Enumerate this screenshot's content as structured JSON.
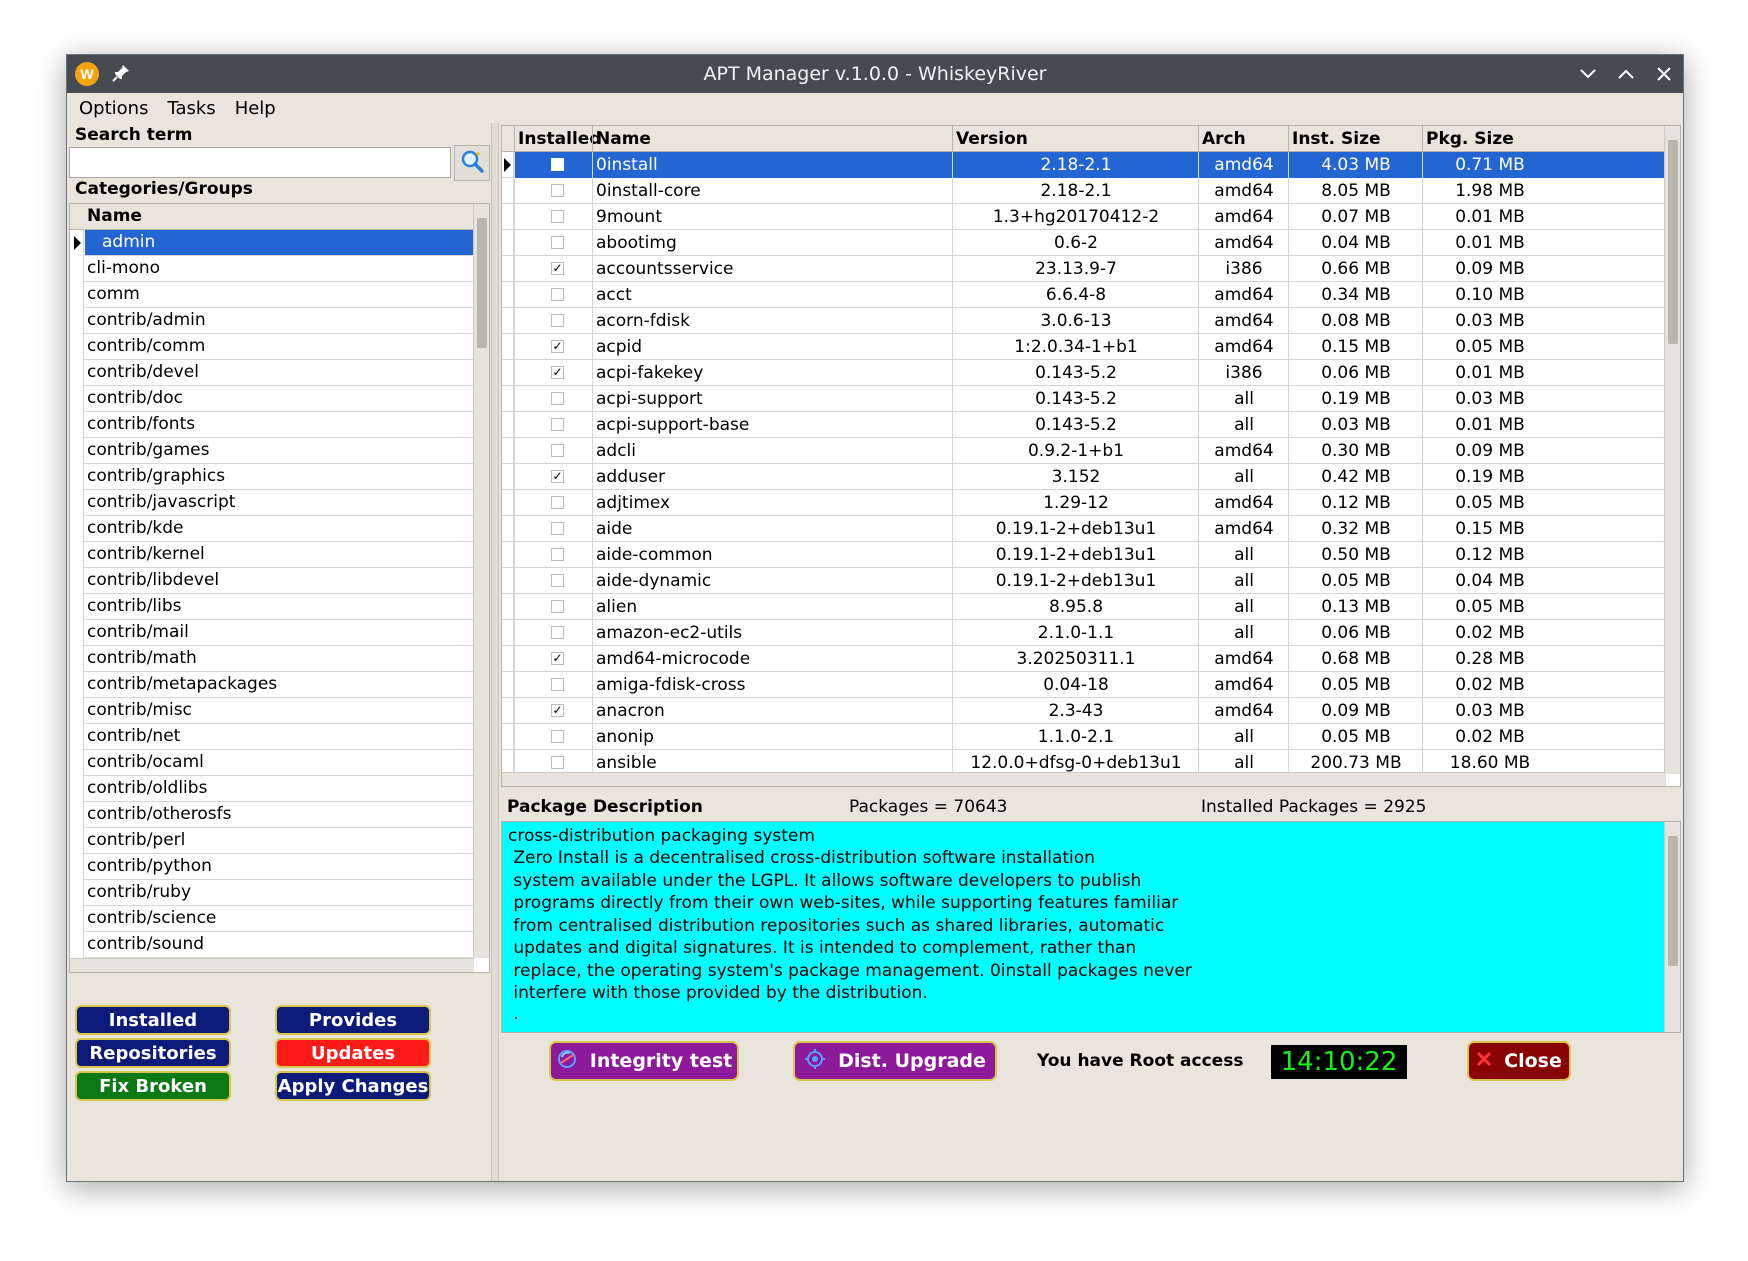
{
  "window": {
    "title": "APT Manager v.1.0.0 - WhiskeyRiver",
    "logo_letter": "W"
  },
  "menu": [
    "Options",
    "Tasks",
    "Help"
  ],
  "left": {
    "search_label": "Search term",
    "search_value": "",
    "categories_label": "Categories/Groups",
    "categories_header": "Name",
    "categories": [
      "admin",
      "cli-mono",
      "comm",
      "contrib/admin",
      "contrib/comm",
      "contrib/devel",
      "contrib/doc",
      "contrib/fonts",
      "contrib/games",
      "contrib/graphics",
      "contrib/javascript",
      "contrib/kde",
      "contrib/kernel",
      "contrib/libdevel",
      "contrib/libs",
      "contrib/mail",
      "contrib/math",
      "contrib/metapackages",
      "contrib/misc",
      "contrib/net",
      "contrib/ocaml",
      "contrib/oldlibs",
      "contrib/otherosfs",
      "contrib/perl",
      "contrib/python",
      "contrib/ruby",
      "contrib/science",
      "contrib/sound"
    ],
    "selected_category": 0,
    "buttons": {
      "installed": "Installed",
      "provides": "Provides",
      "repositories": "Repositories",
      "updates": "Updates",
      "fix_broken": "Fix Broken",
      "apply_changes": "Apply Changes"
    }
  },
  "packages": {
    "headers": [
      "Installed",
      "Name",
      "Version",
      "Arch",
      "Inst. Size",
      "Pkg. Size"
    ],
    "selected": 0,
    "rows": [
      {
        "installed": false,
        "name": "0install",
        "version": "2.18-2.1",
        "arch": "amd64",
        "inst_size": "4.03 MB",
        "pkg_size": "0.71 MB"
      },
      {
        "installed": false,
        "name": "0install-core",
        "version": "2.18-2.1",
        "arch": "amd64",
        "inst_size": "8.05 MB",
        "pkg_size": "1.98 MB"
      },
      {
        "installed": false,
        "name": "9mount",
        "version": "1.3+hg20170412-2",
        "arch": "amd64",
        "inst_size": "0.07 MB",
        "pkg_size": "0.01 MB"
      },
      {
        "installed": false,
        "name": "abootimg",
        "version": "0.6-2",
        "arch": "amd64",
        "inst_size": "0.04 MB",
        "pkg_size": "0.01 MB"
      },
      {
        "installed": true,
        "name": "accountsservice",
        "version": "23.13.9-7",
        "arch": "i386",
        "inst_size": "0.66 MB",
        "pkg_size": "0.09 MB"
      },
      {
        "installed": false,
        "name": "acct",
        "version": "6.6.4-8",
        "arch": "amd64",
        "inst_size": "0.34 MB",
        "pkg_size": "0.10 MB"
      },
      {
        "installed": false,
        "name": "acorn-fdisk",
        "version": "3.0.6-13",
        "arch": "amd64",
        "inst_size": "0.08 MB",
        "pkg_size": "0.03 MB"
      },
      {
        "installed": true,
        "name": "acpid",
        "version": "1:2.0.34-1+b1",
        "arch": "amd64",
        "inst_size": "0.15 MB",
        "pkg_size": "0.05 MB"
      },
      {
        "installed": true,
        "name": "acpi-fakekey",
        "version": "0.143-5.2",
        "arch": "i386",
        "inst_size": "0.06 MB",
        "pkg_size": "0.01 MB"
      },
      {
        "installed": false,
        "name": "acpi-support",
        "version": "0.143-5.2",
        "arch": "all",
        "inst_size": "0.19 MB",
        "pkg_size": "0.03 MB"
      },
      {
        "installed": false,
        "name": "acpi-support-base",
        "version": "0.143-5.2",
        "arch": "all",
        "inst_size": "0.03 MB",
        "pkg_size": "0.01 MB"
      },
      {
        "installed": false,
        "name": "adcli",
        "version": "0.9.2-1+b1",
        "arch": "amd64",
        "inst_size": "0.30 MB",
        "pkg_size": "0.09 MB"
      },
      {
        "installed": true,
        "name": "adduser",
        "version": "3.152",
        "arch": "all",
        "inst_size": "0.42 MB",
        "pkg_size": "0.19 MB"
      },
      {
        "installed": false,
        "name": "adjtimex",
        "version": "1.29-12",
        "arch": "amd64",
        "inst_size": "0.12 MB",
        "pkg_size": "0.05 MB"
      },
      {
        "installed": false,
        "name": "aide",
        "version": "0.19.1-2+deb13u1",
        "arch": "amd64",
        "inst_size": "0.32 MB",
        "pkg_size": "0.15 MB"
      },
      {
        "installed": false,
        "name": "aide-common",
        "version": "0.19.1-2+deb13u1",
        "arch": "all",
        "inst_size": "0.50 MB",
        "pkg_size": "0.12 MB"
      },
      {
        "installed": false,
        "name": "aide-dynamic",
        "version": "0.19.1-2+deb13u1",
        "arch": "all",
        "inst_size": "0.05 MB",
        "pkg_size": "0.04 MB"
      },
      {
        "installed": false,
        "name": "alien",
        "version": "8.95.8",
        "arch": "all",
        "inst_size": "0.13 MB",
        "pkg_size": "0.05 MB"
      },
      {
        "installed": false,
        "name": "amazon-ec2-utils",
        "version": "2.1.0-1.1",
        "arch": "all",
        "inst_size": "0.06 MB",
        "pkg_size": "0.02 MB"
      },
      {
        "installed": true,
        "name": "amd64-microcode",
        "version": "3.20250311.1",
        "arch": "amd64",
        "inst_size": "0.68 MB",
        "pkg_size": "0.28 MB"
      },
      {
        "installed": false,
        "name": "amiga-fdisk-cross",
        "version": "0.04-18",
        "arch": "amd64",
        "inst_size": "0.05 MB",
        "pkg_size": "0.02 MB"
      },
      {
        "installed": true,
        "name": "anacron",
        "version": "2.3-43",
        "arch": "amd64",
        "inst_size": "0.09 MB",
        "pkg_size": "0.03 MB"
      },
      {
        "installed": false,
        "name": "anonip",
        "version": "1.1.0-2.1",
        "arch": "all",
        "inst_size": "0.05 MB",
        "pkg_size": "0.02 MB"
      },
      {
        "installed": false,
        "name": "ansible",
        "version": "12.0.0+dfsg-0+deb13u1",
        "arch": "all",
        "inst_size": "200.73 MB",
        "pkg_size": "18.60 MB"
      }
    ]
  },
  "description": {
    "label": "Package Description",
    "packages_count": "Packages = 70643",
    "installed_count": "Installed Packages = 2925",
    "lines": [
      "cross-distribution packaging system",
      " Zero Install is a decentralised cross-distribution software installation",
      " system available under the LGPL. It allows software developers to publish",
      " programs directly from their own web-sites, while supporting features familiar",
      " from centralised distribution repositories such as shared libraries, automatic",
      " updates and digital signatures. It is intended to complement, rather than",
      " replace, the operating system's package management. 0install packages never",
      " interfere with those provided by the distribution.",
      " ."
    ]
  },
  "footer": {
    "integrity_test": "Integrity test",
    "dist_upgrade": "Dist. Upgrade",
    "root_access": "You have Root access",
    "clock": "14:10:22",
    "close": "Close"
  },
  "colors": {
    "selection": "#2365d3",
    "description_bg": "#00ffff",
    "navy_button": "#0c1a7a",
    "red_button": "#ff1a1a",
    "green_button": "#0b7a14",
    "purple_button": "#8d1a9a",
    "close_button": "#8a0303",
    "clock_text": "#19f019"
  },
  "icons": [
    "logo-icon",
    "pin-icon",
    "minimize-icon",
    "maximize-icon",
    "close-icon",
    "search-icon",
    "integrity-icon",
    "target-icon",
    "close-x-icon"
  ]
}
